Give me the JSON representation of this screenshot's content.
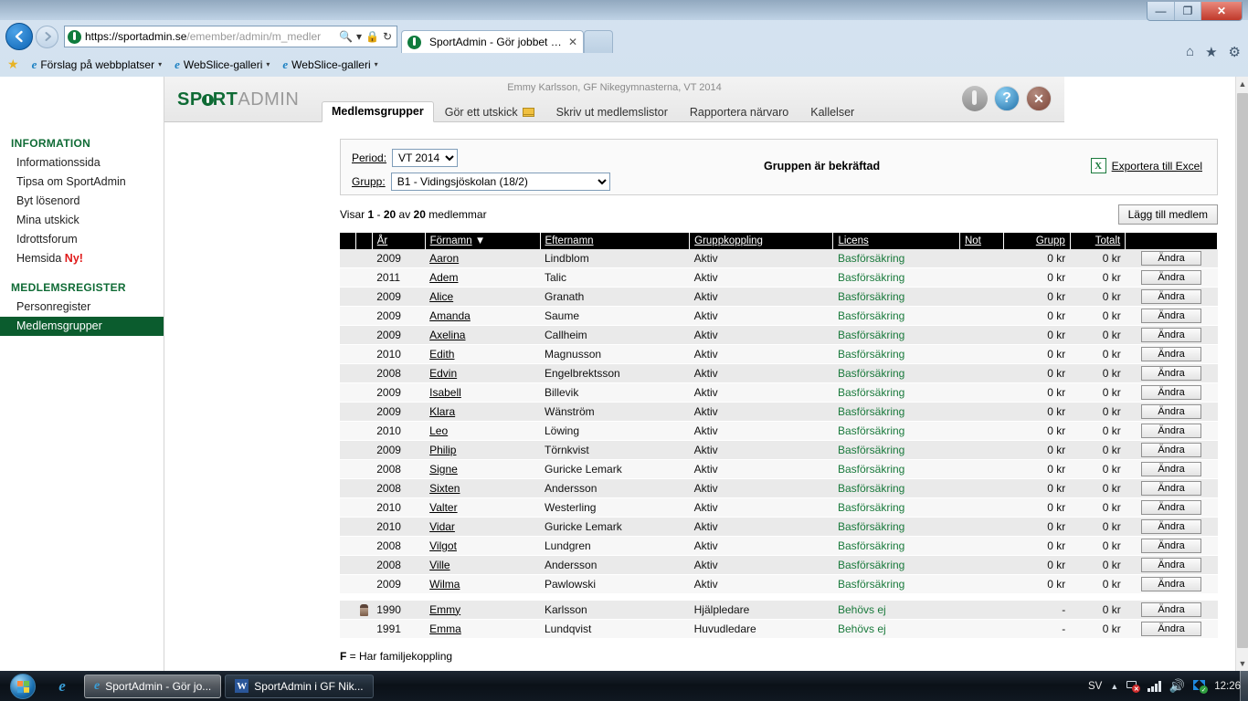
{
  "browser": {
    "url_secure": "https://sportadmin.se",
    "url_path": "/emember/admin/m_medler",
    "tab_title": "SportAdmin - Gör jobbet åt...",
    "tab_close": "✕",
    "back_icon": "◀",
    "forward_icon": "▶",
    "search_icon": "🔍",
    "lock_icon": "🔒",
    "refresh_icon": "↻",
    "dropdown_icon": "▾",
    "win_minimize": "—",
    "win_restore": "❐",
    "win_close": "✕",
    "home_icon": "⌂",
    "favorites_icon": "★",
    "tools_icon": "⚙",
    "favbar": [
      {
        "label": "Förslag på webbplatser",
        "caret": "▾"
      },
      {
        "label": "WebSlice-galleri",
        "caret": "▾"
      },
      {
        "label": "WebSlice-galleri",
        "caret": "▾"
      }
    ]
  },
  "app": {
    "brand_sport": "SP",
    "brand_sport2": "RT",
    "brand_admin": "ADMIN",
    "user_line": "Emmy Karlsson, GF Nikegymnasterna, VT 2014",
    "header_icons": {
      "logo": "",
      "help": "?",
      "close": "✕"
    },
    "tabs": [
      {
        "label": "Medlemsgrupper",
        "active": true,
        "icon": ""
      },
      {
        "label": "Gör ett utskick",
        "active": false,
        "icon": "mail-icon"
      },
      {
        "label": "Skriv ut medlemslistor",
        "active": false,
        "icon": ""
      },
      {
        "label": "Rapportera närvaro",
        "active": false,
        "icon": ""
      },
      {
        "label": "Kallelser",
        "active": false,
        "icon": ""
      }
    ]
  },
  "sidebar": {
    "groups": [
      {
        "title": "INFORMATION",
        "items": [
          {
            "label": "Informationssida",
            "active": false,
            "badge": ""
          },
          {
            "label": "Tipsa om SportAdmin",
            "active": false,
            "badge": ""
          },
          {
            "label": "Byt lösenord",
            "active": false,
            "badge": ""
          },
          {
            "label": "Mina utskick",
            "active": false,
            "badge": ""
          },
          {
            "label": "Idrottsforum",
            "active": false,
            "badge": ""
          },
          {
            "label": "Hemsida ",
            "active": false,
            "badge": "Ny!"
          }
        ]
      },
      {
        "title": "MEDLEMSREGISTER",
        "items": [
          {
            "label": "Personregister",
            "active": false,
            "badge": ""
          },
          {
            "label": "Medlemsgrupper",
            "active": true,
            "badge": ""
          }
        ]
      }
    ]
  },
  "filters": {
    "period_label": "Period:",
    "period_value": "VT 2014",
    "period_options": [
      "VT 2014"
    ],
    "group_label": "Grupp:",
    "group_value": "B1 - Vidingsjöskolan (18/2)",
    "group_options": [
      "B1 - Vidingsjöskolan (18/2)"
    ],
    "confirmed_text": "Gruppen är bekräftad",
    "export_label": "Exportera till Excel",
    "export_icon": "X"
  },
  "summary": {
    "showing_prefix": "Visar ",
    "range_from": "1",
    "dash": " - ",
    "range_to": "20",
    "of_word": " av ",
    "total": "20",
    "suffix": " medlemmar",
    "add_button": "Lägg till medlem"
  },
  "table": {
    "columns": [
      "",
      "",
      "År",
      "Förnamn",
      "Efternamn",
      "Gruppkoppling",
      "Licens",
      "Not",
      "Grupp",
      "Totalt",
      ""
    ],
    "sort_column": "Förnamn",
    "sort_icon": "▼",
    "edit_label": "Ändra",
    "rows": [
      {
        "avatar": false,
        "ar": "2009",
        "fornamn": "Aaron",
        "efternamn": "Lindblom",
        "grupp": "Aktiv",
        "licens": "Basförsäkring",
        "not": "",
        "grupp_kr": "0 kr",
        "totalt": "0 kr"
      },
      {
        "avatar": false,
        "ar": "2011",
        "fornamn": "Adem",
        "efternamn": "Talic",
        "grupp": "Aktiv",
        "licens": "Basförsäkring",
        "not": "",
        "grupp_kr": "0 kr",
        "totalt": "0 kr"
      },
      {
        "avatar": false,
        "ar": "2009",
        "fornamn": "Alice",
        "efternamn": "Granath",
        "grupp": "Aktiv",
        "licens": "Basförsäkring",
        "not": "",
        "grupp_kr": "0 kr",
        "totalt": "0 kr"
      },
      {
        "avatar": false,
        "ar": "2009",
        "fornamn": "Amanda",
        "efternamn": "Saume",
        "grupp": "Aktiv",
        "licens": "Basförsäkring",
        "not": "",
        "grupp_kr": "0 kr",
        "totalt": "0 kr"
      },
      {
        "avatar": false,
        "ar": "2009",
        "fornamn": "Axelina",
        "efternamn": "Callheim",
        "grupp": "Aktiv",
        "licens": "Basförsäkring",
        "not": "",
        "grupp_kr": "0 kr",
        "totalt": "0 kr"
      },
      {
        "avatar": false,
        "ar": "2010",
        "fornamn": "Edith",
        "efternamn": "Magnusson",
        "grupp": "Aktiv",
        "licens": "Basförsäkring",
        "not": "",
        "grupp_kr": "0 kr",
        "totalt": "0 kr"
      },
      {
        "avatar": false,
        "ar": "2008",
        "fornamn": "Edvin",
        "efternamn": "Engelbrektsson",
        "grupp": "Aktiv",
        "licens": "Basförsäkring",
        "not": "",
        "grupp_kr": "0 kr",
        "totalt": "0 kr"
      },
      {
        "avatar": false,
        "ar": "2009",
        "fornamn": "Isabell",
        "efternamn": "Billevik",
        "grupp": "Aktiv",
        "licens": "Basförsäkring",
        "not": "",
        "grupp_kr": "0 kr",
        "totalt": "0 kr"
      },
      {
        "avatar": false,
        "ar": "2009",
        "fornamn": "Klara",
        "efternamn": "Wänström",
        "grupp": "Aktiv",
        "licens": "Basförsäkring",
        "not": "",
        "grupp_kr": "0 kr",
        "totalt": "0 kr"
      },
      {
        "avatar": false,
        "ar": "2010",
        "fornamn": "Leo",
        "efternamn": "Löwing",
        "grupp": "Aktiv",
        "licens": "Basförsäkring",
        "not": "",
        "grupp_kr": "0 kr",
        "totalt": "0 kr"
      },
      {
        "avatar": false,
        "ar": "2009",
        "fornamn": "Philip",
        "efternamn": "Törnkvist",
        "grupp": "Aktiv",
        "licens": "Basförsäkring",
        "not": "",
        "grupp_kr": "0 kr",
        "totalt": "0 kr"
      },
      {
        "avatar": false,
        "ar": "2008",
        "fornamn": "Signe",
        "efternamn": "Guricke Lemark",
        "grupp": "Aktiv",
        "licens": "Basförsäkring",
        "not": "",
        "grupp_kr": "0 kr",
        "totalt": "0 kr"
      },
      {
        "avatar": false,
        "ar": "2008",
        "fornamn": "Sixten",
        "efternamn": "Andersson",
        "grupp": "Aktiv",
        "licens": "Basförsäkring",
        "not": "",
        "grupp_kr": "0 kr",
        "totalt": "0 kr"
      },
      {
        "avatar": false,
        "ar": "2010",
        "fornamn": "Valter",
        "efternamn": "Westerling",
        "grupp": "Aktiv",
        "licens": "Basförsäkring",
        "not": "",
        "grupp_kr": "0 kr",
        "totalt": "0 kr"
      },
      {
        "avatar": false,
        "ar": "2010",
        "fornamn": "Vidar",
        "efternamn": "Guricke Lemark",
        "grupp": "Aktiv",
        "licens": "Basförsäkring",
        "not": "",
        "grupp_kr": "0 kr",
        "totalt": "0 kr"
      },
      {
        "avatar": false,
        "ar": "2008",
        "fornamn": "Vilgot",
        "efternamn": "Lundgren",
        "grupp": "Aktiv",
        "licens": "Basförsäkring",
        "not": "",
        "grupp_kr": "0 kr",
        "totalt": "0 kr"
      },
      {
        "avatar": false,
        "ar": "2008",
        "fornamn": "Ville",
        "efternamn": "Andersson",
        "grupp": "Aktiv",
        "licens": "Basförsäkring",
        "not": "",
        "grupp_kr": "0 kr",
        "totalt": "0 kr"
      },
      {
        "avatar": false,
        "ar": "2009",
        "fornamn": "Wilma",
        "efternamn": "Pawlowski",
        "grupp": "Aktiv",
        "licens": "Basförsäkring",
        "not": "",
        "grupp_kr": "0 kr",
        "totalt": "0 kr"
      }
    ],
    "leader_rows": [
      {
        "avatar": true,
        "ar": "1990",
        "fornamn": "Emmy",
        "efternamn": "Karlsson",
        "grupp": "Hjälpledare",
        "licens": "Behövs ej",
        "not": "",
        "grupp_kr": "-",
        "totalt": "0 kr"
      },
      {
        "avatar": false,
        "ar": "1991",
        "fornamn": "Emma",
        "efternamn": "Lundqvist",
        "grupp": "Huvudledare",
        "licens": "Behövs ej",
        "not": "",
        "grupp_kr": "-",
        "totalt": "0 kr"
      }
    ],
    "legend_key": "F",
    "legend_text": " = Har familjekoppling"
  },
  "taskbar": {
    "start_label": "",
    "buttons": [
      {
        "label": "SportAdmin - Gör jo...",
        "icon": "ie-icon",
        "active": true
      },
      {
        "label": "SportAdmin i GF Nik...",
        "icon": "word-icon",
        "active": false
      }
    ],
    "tray": {
      "language": "SV",
      "arrow": "▲",
      "clock": "12:26"
    }
  },
  "colors": {
    "brand_green": "#0f6b35",
    "active_nav": "#0b5c2e",
    "license_green": "#1a7a3c",
    "alert_red": "#e01b1b",
    "header_black": "#000000"
  }
}
